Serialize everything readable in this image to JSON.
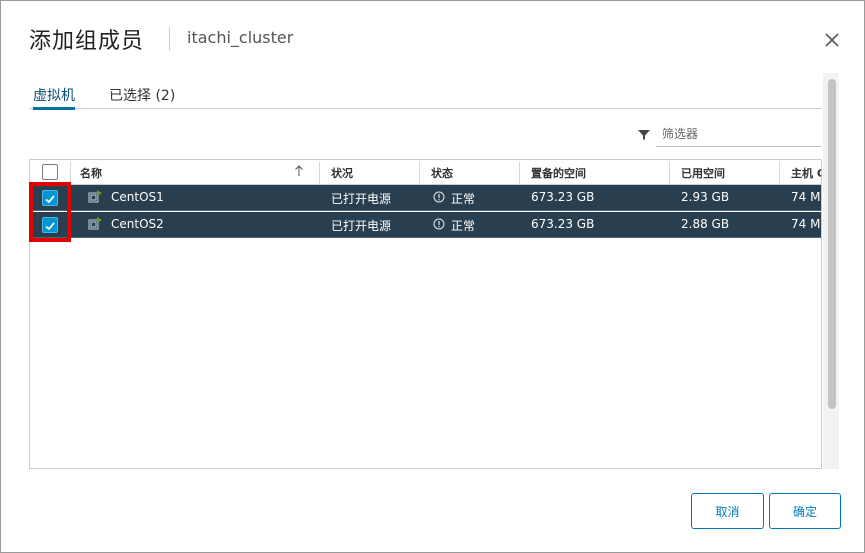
{
  "dialog": {
    "title": "添加组成员",
    "subtitle": "itachi_cluster"
  },
  "tabs": [
    {
      "label": "虚拟机",
      "active": true
    },
    {
      "label": "已选择 (2)",
      "active": false
    }
  ],
  "filter": {
    "placeholder": "筛选器",
    "value": ""
  },
  "grid": {
    "columns": [
      "名称",
      "状况",
      "状态",
      "置备的空间",
      "已用空间",
      "主机 C"
    ],
    "sort": {
      "column": "名称",
      "direction": "ascending",
      "icon": "arrow-up-icon"
    },
    "rows": [
      {
        "selected": true,
        "name": "CentOS1",
        "condition": "已打开电源",
        "status": "正常",
        "provisioned": "673.23 GB",
        "used": "2.93 GB",
        "host": "74 M"
      },
      {
        "selected": true,
        "name": "CentOS2",
        "condition": "已打开电源",
        "status": "正常",
        "provisioned": "673.23 GB",
        "used": "2.88 GB",
        "host": "74 M"
      }
    ]
  },
  "buttons": {
    "cancel": "取消",
    "ok": "确定"
  },
  "colors": {
    "selected_row_bg": "#293f4f",
    "checkbox_checked": "#0095d3",
    "accent": "#0079b8",
    "highlight_box": "#e00000"
  },
  "icons": {
    "close": "close-icon",
    "filter": "filter-icon",
    "vm": "vm-icon",
    "status_ok": "info-circle-icon"
  }
}
